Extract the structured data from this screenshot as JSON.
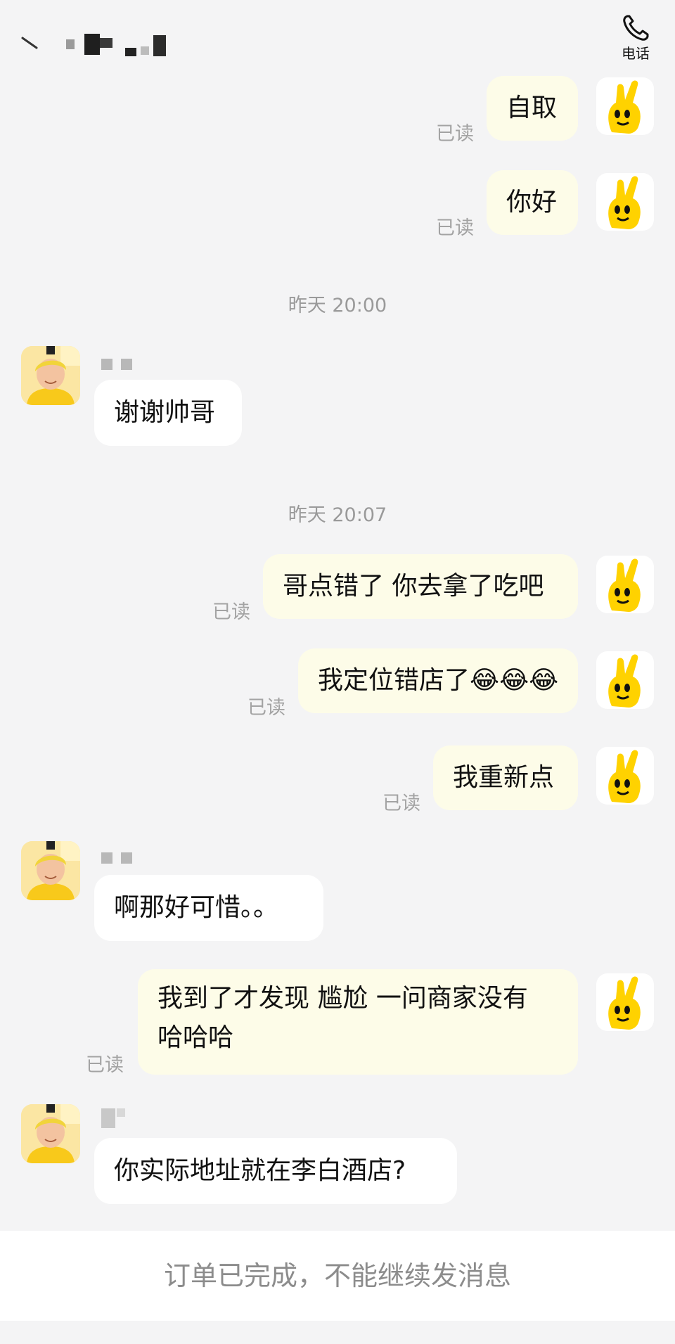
{
  "header": {
    "call_label": "电话"
  },
  "messages": [
    {
      "text": "自取",
      "read": "已读"
    },
    {
      "text": "你好",
      "read": "已读"
    },
    {
      "time": "昨天 20:00"
    },
    {
      "text": "谢谢帅哥"
    },
    {
      "time": "昨天 20:07"
    },
    {
      "text": "哥点错了 你去拿了吃吧",
      "read": "已读"
    },
    {
      "text": "我定位错店了😂😂😂",
      "read": "已读"
    },
    {
      "text": "我重新点",
      "read": "已读"
    },
    {
      "text": "啊那好可惜。。"
    },
    {
      "text_line1": "我到了才发现 尴尬 一问商家没有",
      "text_line2": "哈哈哈",
      "read": "已读"
    },
    {
      "text": "你实际地址就在李白酒店?"
    }
  ],
  "footer": {
    "notice": "订单已完成，不能继续发消息"
  },
  "colors": {
    "background": "#f4f4f5",
    "outgoing_bubble": "#fdfce8",
    "incoming_bubble": "#ffffff",
    "avatar_yellow": "#ffd200"
  },
  "icons": [
    "back-icon",
    "phone-icon",
    "yellow-hand-avatar",
    "user-avatar"
  ]
}
